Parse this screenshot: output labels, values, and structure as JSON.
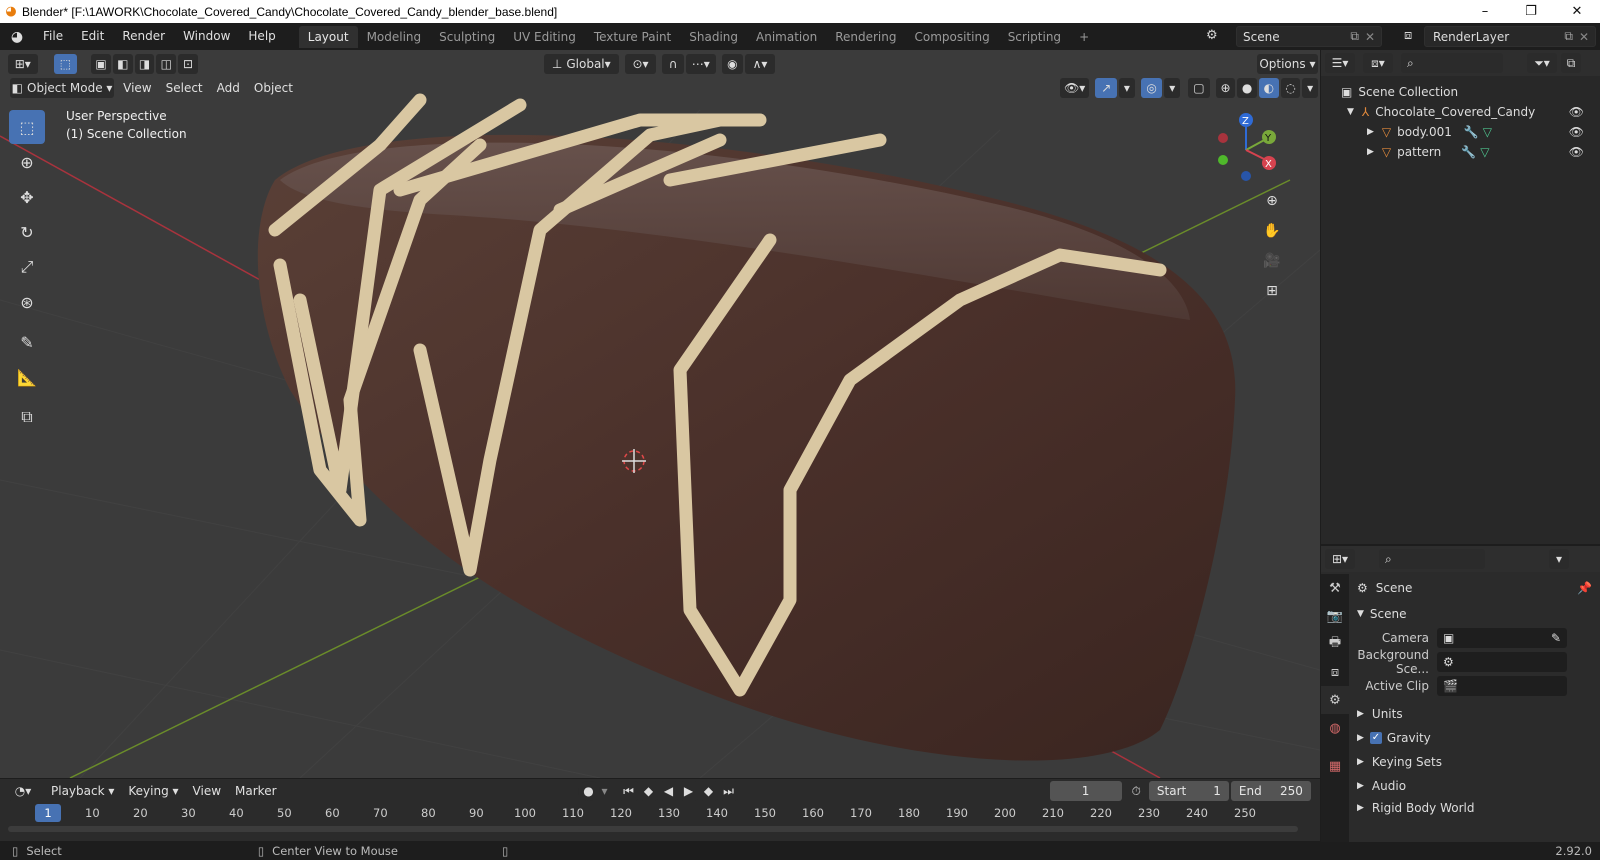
{
  "window": {
    "title": "Blender* [F:\\1AWORK\\Chocolate_Covered_Candy\\Chocolate_Covered_Candy_blender_base.blend]",
    "controls": [
      "–",
      "❐",
      "✕"
    ]
  },
  "topbar": {
    "menus": [
      "File",
      "Edit",
      "Render",
      "Window",
      "Help"
    ],
    "workspaces": [
      "Layout",
      "Modeling",
      "Sculpting",
      "UV Editing",
      "Texture Paint",
      "Shading",
      "Animation",
      "Rendering",
      "Compositing",
      "Scripting"
    ],
    "active_workspace": "Layout",
    "add_workspace": "+",
    "scene": "Scene",
    "view_layer": "RenderLayer"
  },
  "viewport": {
    "transform_orientation": "Global",
    "options": "Options",
    "mode": "Object Mode",
    "menus": [
      "View",
      "Select",
      "Add",
      "Object"
    ],
    "perspective_label": "User Perspective",
    "collection_label": "(1) Scene Collection",
    "gizmo": {
      "x": "X",
      "y": "Y",
      "z": "Z"
    }
  },
  "outliner": {
    "root": "Scene Collection",
    "items": [
      {
        "label": "Chocolate_Covered_Candy",
        "type": "empty"
      },
      {
        "label": "body.001",
        "type": "mesh"
      },
      {
        "label": "pattern",
        "type": "mesh"
      }
    ]
  },
  "properties": {
    "context": "Scene",
    "panel_title": "Scene",
    "fields": [
      {
        "label": "Camera",
        "value": ""
      },
      {
        "label": "Background Sce...",
        "value": ""
      },
      {
        "label": "Active Clip",
        "value": ""
      }
    ],
    "panels": [
      "Units",
      "Gravity",
      "Keying Sets",
      "Audio",
      "Rigid Body World"
    ],
    "gravity_checked": true
  },
  "timeline": {
    "menus": [
      "Playback",
      "Keying",
      "View",
      "Marker"
    ],
    "current_frame": "1",
    "start_label": "Start",
    "start": "1",
    "end_label": "End",
    "end": "250",
    "ticks": [
      "1",
      "10",
      "20",
      "30",
      "40",
      "50",
      "60",
      "70",
      "80",
      "90",
      "100",
      "110",
      "120",
      "130",
      "140",
      "150",
      "160",
      "170",
      "180",
      "190",
      "200",
      "210",
      "220",
      "230",
      "240",
      "250"
    ]
  },
  "statusbar": {
    "select": "Select",
    "center_view": "Center View to Mouse",
    "version": "2.92.0"
  }
}
